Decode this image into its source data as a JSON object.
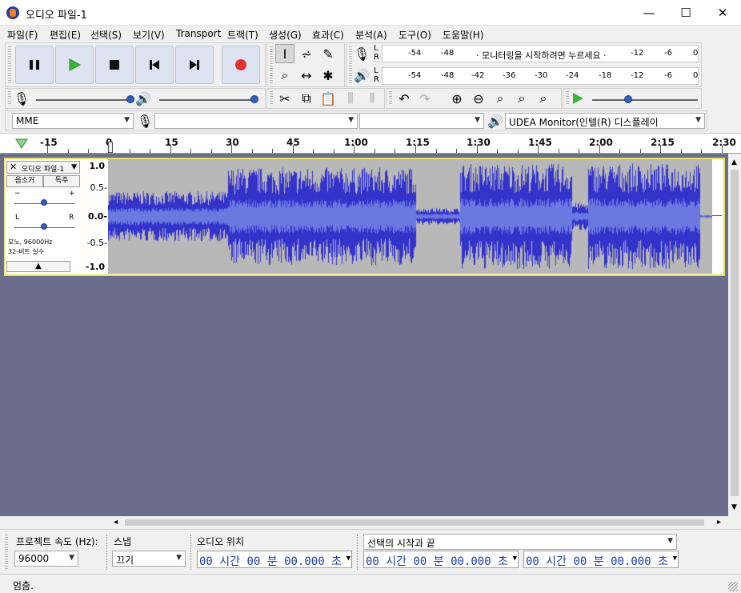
{
  "window": {
    "title": "오디오 파일-1",
    "minimize": "—",
    "maximize": "☐",
    "close": "✕"
  },
  "menu": [
    "파일(F)",
    "편집(E)",
    "선택(S)",
    "보기(V)",
    "Transport",
    "트랙(T)",
    "생성(G)",
    "효과(C)",
    "분석(A)",
    "도구(O)",
    "도움말(H)"
  ],
  "meters": {
    "rec_scale": [
      "-54",
      "-48",
      "-12",
      "-6",
      "0"
    ],
    "rec_hint": "· 모니터링을 시작하려면 누르세요 ·",
    "play_scale": [
      "-54",
      "-48",
      "-42",
      "-36",
      "-30",
      "-24",
      "-18",
      "-12",
      "-6",
      "0"
    ],
    "lr_top": "L R",
    "lr_bottom": "L R"
  },
  "devices": {
    "host": "MME",
    "rec_device": "",
    "channels": "",
    "play_device": "UDEA Monitor(인텔(R) 디스플레이"
  },
  "ruler": {
    "labels": [
      "-15",
      "0",
      "15",
      "30",
      "45",
      "1:00",
      "1:15",
      "1:30",
      "1:45",
      "2:00",
      "2:15",
      "2:30"
    ]
  },
  "track": {
    "name": "오디오 파일-1",
    "mute": "음소거",
    "solo": "독주",
    "gain_minus": "−",
    "gain_plus": "+",
    "pan_l": "L",
    "pan_r": "R",
    "info1": "모노, 96000Hz",
    "info2": "32-비트 실수",
    "scale": [
      "1.0",
      "0.5-",
      "0.0-",
      "-0.5-",
      "-1.0"
    ]
  },
  "bottom": {
    "rate_label": "프로젝트 속도 (Hz):",
    "rate_value": "96000",
    "snap_label": "스냅",
    "snap_value": "끄기",
    "pos_label": "오디오 위치",
    "pos_value": "00 시간 00 분 00.000 초",
    "sel_label": "선택의 시작과 끝",
    "sel_start": "00 시간 00 분 00.000 초",
    "sel_end": "00 시간 00 분 00.000 초"
  },
  "status": "멈춤.",
  "colors": {
    "wave": "#3333cc",
    "wave_bg": "#b8b8b8",
    "track_area": "#6a6d8c",
    "play": "#3cb43c",
    "record": "#e03030"
  }
}
